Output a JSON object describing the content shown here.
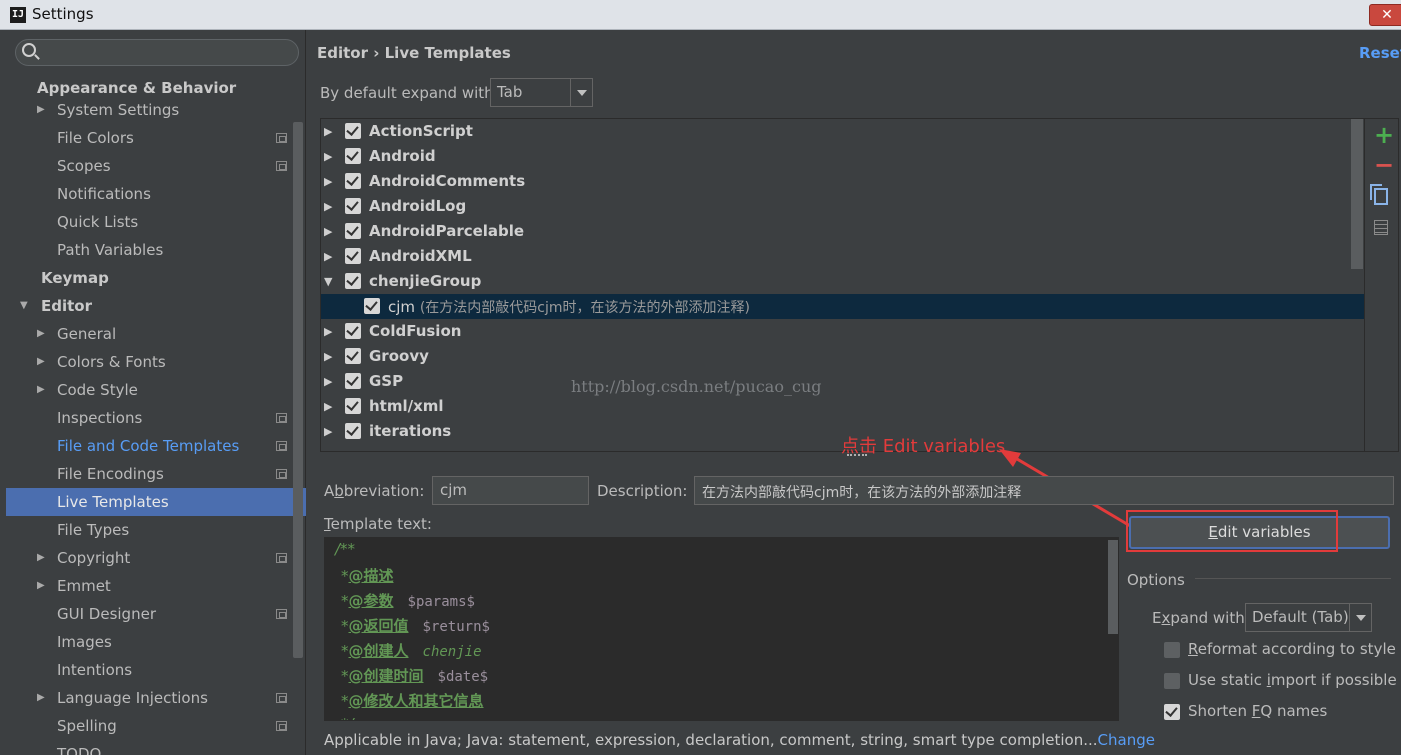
{
  "window": {
    "title": "Settings",
    "app_icon": "IJ"
  },
  "sidebar": {
    "search_placeholder": "",
    "items": [
      {
        "label": "Appearance & Behavior",
        "level": 0,
        "bold": true
      },
      {
        "label": "System Settings",
        "level": 1,
        "arrow": "right"
      },
      {
        "label": "File Colors",
        "level": 1,
        "cfg": true
      },
      {
        "label": "Scopes",
        "level": 1,
        "cfg": true
      },
      {
        "label": "Notifications",
        "level": 1
      },
      {
        "label": "Quick Lists",
        "level": 1
      },
      {
        "label": "Path Variables",
        "level": 1
      },
      {
        "label": "Keymap",
        "level": 0,
        "bold": true
      },
      {
        "label": "Editor",
        "level": 0,
        "bold": true,
        "arrow": "down"
      },
      {
        "label": "General",
        "level": 1,
        "arrow": "right"
      },
      {
        "label": "Colors & Fonts",
        "level": 1,
        "arrow": "right"
      },
      {
        "label": "Code Style",
        "level": 1,
        "arrow": "right"
      },
      {
        "label": "Inspections",
        "level": 1,
        "cfg": true
      },
      {
        "label": "File and Code Templates",
        "level": 1,
        "cfg": true,
        "link": true
      },
      {
        "label": "File Encodings",
        "level": 1,
        "cfg": true
      },
      {
        "label": "Live Templates",
        "level": 1,
        "selected": true
      },
      {
        "label": "File Types",
        "level": 1
      },
      {
        "label": "Copyright",
        "level": 1,
        "arrow": "right",
        "cfg": true
      },
      {
        "label": "Emmet",
        "level": 1,
        "arrow": "right"
      },
      {
        "label": "GUI Designer",
        "level": 1,
        "cfg": true
      },
      {
        "label": "Images",
        "level": 1
      },
      {
        "label": "Intentions",
        "level": 1
      },
      {
        "label": "Language Injections",
        "level": 1,
        "arrow": "right",
        "cfg": true
      },
      {
        "label": "Spelling",
        "level": 1,
        "cfg": true
      },
      {
        "label": "TODO",
        "level": 1
      }
    ]
  },
  "main": {
    "breadcrumb": "Editor › Live Templates",
    "reset_label": "Reset",
    "expand_label": "By default expand with",
    "expand_value": "Tab",
    "groups": [
      {
        "name": "ActionScript",
        "checked": true,
        "expanded": false
      },
      {
        "name": "Android",
        "checked": true,
        "expanded": false
      },
      {
        "name": "AndroidComments",
        "checked": true,
        "expanded": false
      },
      {
        "name": "AndroidLog",
        "checked": true,
        "expanded": false
      },
      {
        "name": "AndroidParcelable",
        "checked": true,
        "expanded": false
      },
      {
        "name": "AndroidXML",
        "checked": true,
        "expanded": false
      },
      {
        "name": "chenjieGroup",
        "checked": true,
        "expanded": true
      },
      {
        "name": "ColdFusion",
        "checked": true,
        "expanded": false
      },
      {
        "name": "Groovy",
        "checked": true,
        "expanded": false
      },
      {
        "name": "GSP",
        "checked": true,
        "expanded": false
      },
      {
        "name": "html/xml",
        "checked": true,
        "expanded": false
      },
      {
        "name": "iterations",
        "checked": true,
        "expanded": false
      }
    ],
    "selected_template": {
      "abbr": "cjm",
      "desc": "(在方法内部敲代码cjm时，在该方法的外部添加注释)"
    },
    "watermark": "http://blog.csdn.net/pucao_cug",
    "annotation": "点击 Edit variables",
    "abbreviation_label_pre": "A",
    "abbreviation_label_mn": "b",
    "abbreviation_label_post": "breviation:",
    "abbreviation_value": "cjm",
    "description_label": "Description:",
    "description_value": "在方法内部敲代码cjm时，在该方法的外部添加注释",
    "template_text_label_mn": "T",
    "template_text_label_post": "emplate text:",
    "template_lines": [
      {
        "prefix": "/**",
        "tag": "",
        "var": ""
      },
      {
        "prefix": "*",
        "tag": "@描述",
        "var": ""
      },
      {
        "prefix": "*",
        "tag": "@参数",
        "var": "$params$"
      },
      {
        "prefix": "*",
        "tag": "@返回值",
        "var": "$return$"
      },
      {
        "prefix": "*",
        "tag": "@创建人",
        "plain": "chenjie"
      },
      {
        "prefix": "*",
        "tag": "@创建时间",
        "var": "$date$"
      },
      {
        "prefix": "*",
        "tag": "@修改人和其它信息",
        "var": ""
      },
      {
        "prefix": "*/",
        "tag": "",
        "var": ""
      }
    ],
    "edit_variables_mn": "E",
    "edit_variables_post": "dit variables",
    "options_label": "Options",
    "expand_with_pre": "E",
    "expand_with_mn": "x",
    "expand_with_post": "pand with",
    "expand_with_value": "Default (Tab)",
    "opt_reformat_mn": "R",
    "opt_reformat_post": "eformat according to style",
    "opt_static_pre": "Use static ",
    "opt_static_mn": "i",
    "opt_static_post": "mport if possible",
    "opt_shorten_pre": "Shorten ",
    "opt_shorten_mn": "F",
    "opt_shorten_post": "Q names",
    "applicable_text": "Applicable in Java; Java: statement, expression, declaration, comment, string, smart type completion...",
    "change_label": "Change"
  }
}
